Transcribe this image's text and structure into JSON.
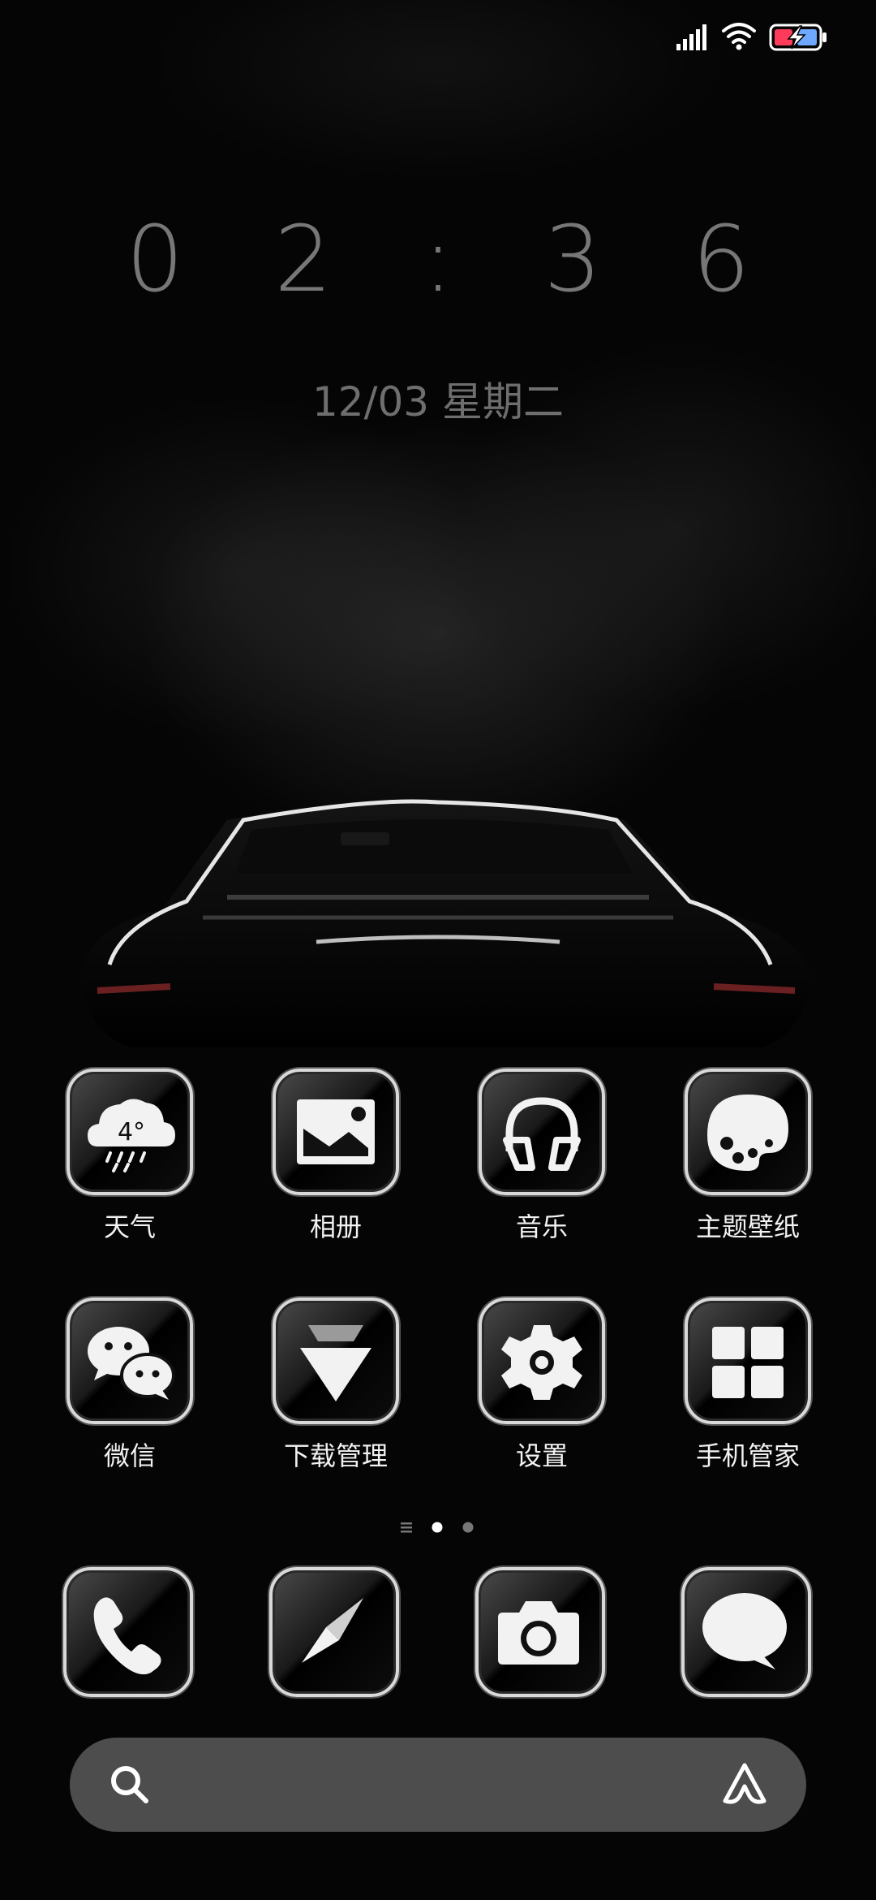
{
  "status_bar": {
    "icons": [
      "signal-icon",
      "wifi-icon",
      "battery-charging-icon"
    ]
  },
  "clock": {
    "time": "02:36",
    "time_display": "0 2 : 3 6",
    "date": "12/03 星期二"
  },
  "apps_row1": [
    {
      "label": "天气",
      "icon": "weather-icon",
      "badge": "4°"
    },
    {
      "label": "相册",
      "icon": "gallery-icon"
    },
    {
      "label": "音乐",
      "icon": "music-icon"
    },
    {
      "label": "主题壁纸",
      "icon": "themes-icon"
    }
  ],
  "apps_row2": [
    {
      "label": "微信",
      "icon": "wechat-icon"
    },
    {
      "label": "下载管理",
      "icon": "download-icon"
    },
    {
      "label": "设置",
      "icon": "settings-icon"
    },
    {
      "label": "手机管家",
      "icon": "security-icon"
    }
  ],
  "page_indicator": {
    "pages": 2,
    "current": 1
  },
  "dock": [
    {
      "icon": "phone-icon"
    },
    {
      "icon": "browser-icon"
    },
    {
      "icon": "camera-icon"
    },
    {
      "icon": "messages-icon"
    }
  ],
  "search_bar": {
    "icons": [
      "search-icon",
      "assistant-icon"
    ]
  },
  "colors": {
    "background": "#050505",
    "icon_border": "#d9d9d9",
    "search_bar": "#4d4d4d",
    "clock_text": "#777777"
  }
}
